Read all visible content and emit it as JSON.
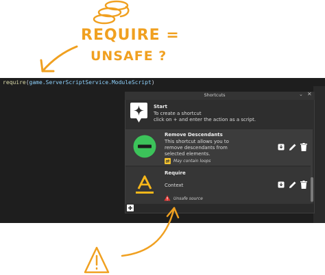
{
  "annotation": {
    "line1": "REQUIRE =",
    "line2": "UNSAFE ?"
  },
  "editor": {
    "code_fn": "require",
    "code_open": "(",
    "code_path": "game.ServerScriptService.ModuleScript",
    "code_close": ")"
  },
  "widget": {
    "title": "Shortcuts",
    "collapse_glyph": "⌄",
    "close_glyph": "✕",
    "start": {
      "title": "Start",
      "desc_line1": "To create a shortcut",
      "desc_line2": "click on + and enter the action as a script."
    },
    "items": [
      {
        "title": "Remove Descendants",
        "desc_line1": "This shortcut allows you to",
        "desc_line2": "remove descendants from",
        "desc_line3": "selected elements.",
        "warning": "May contain loops",
        "icon": "minus-circle-icon",
        "icon_color": "#3cc35a"
      },
      {
        "title": "Require",
        "desc_line1": "Context",
        "warning": "Unsafe source",
        "icon": "letter-a-icon",
        "icon_color": "#f7b71a"
      }
    ],
    "add_glyph": "+"
  },
  "colors": {
    "annotation": "#f0a020",
    "warning_red": "#e53935",
    "loop_yellow": "#f2c230"
  }
}
